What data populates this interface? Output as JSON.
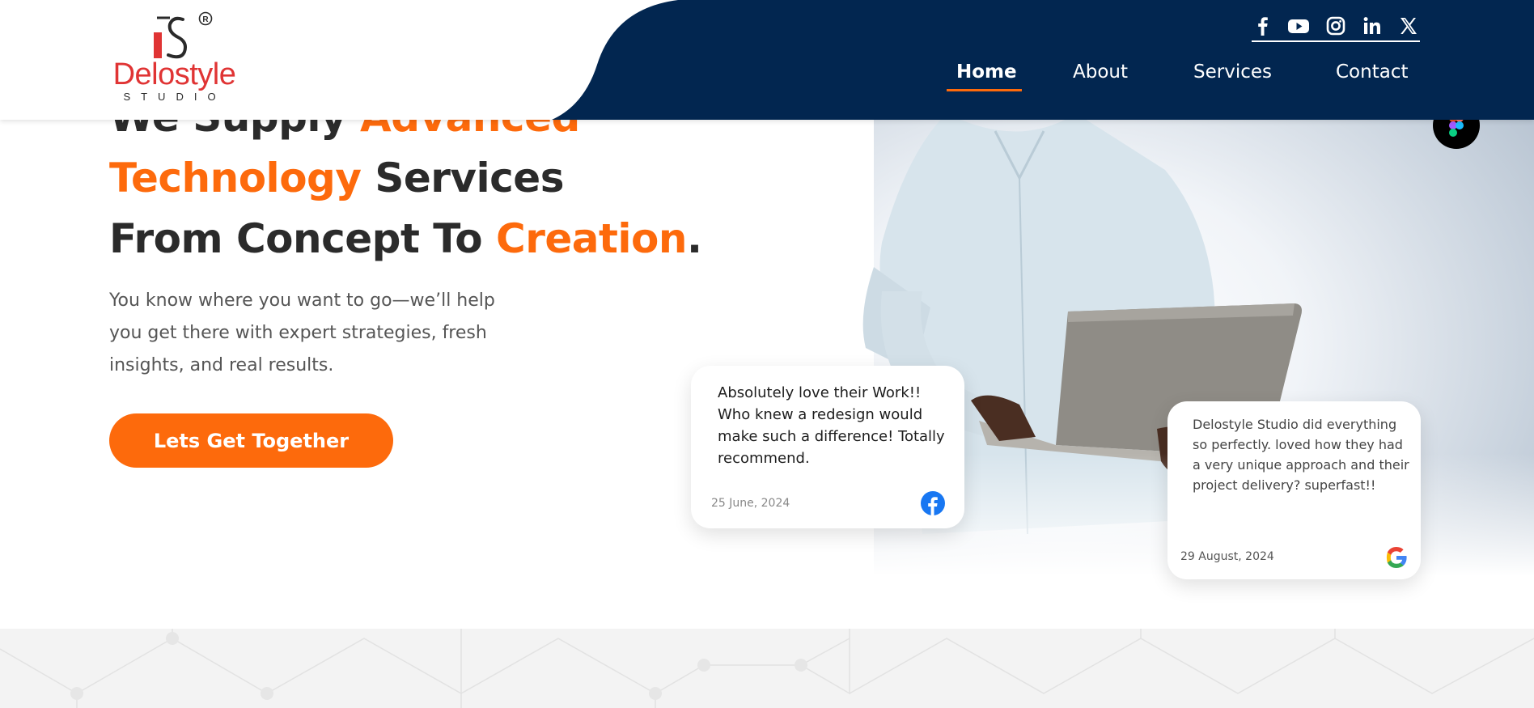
{
  "brand": {
    "name": "Delostyle",
    "subtitle": "STUDIO",
    "mark": "DS",
    "registered": "®",
    "primary_color": "#fd6a0c",
    "navy_color": "#022650",
    "logo_red": "#e03434"
  },
  "social": {
    "icons": [
      "facebook-icon",
      "youtube-icon",
      "instagram-icon",
      "linkedin-icon",
      "x-icon"
    ]
  },
  "nav": {
    "items": [
      {
        "label": "Home",
        "active": true
      },
      {
        "label": "About",
        "active": false
      },
      {
        "label": "Services",
        "active": false
      },
      {
        "label": "Contact",
        "active": false
      }
    ]
  },
  "hero": {
    "headline": {
      "line1_a": "We Supply ",
      "line1_b": "Advanced",
      "line2_a": "Technology",
      "line2_b": " Services",
      "line3_a": "From Concept To ",
      "line3_b": "Creation",
      "line3_c": "."
    },
    "subtext": "You know where you want to go—we’ll help you get there with expert strategies, fresh insights, and real results.",
    "cta_label": "Lets Get Together"
  },
  "reviews": [
    {
      "text": "Absolutely love their Work!! Who knew a redesign would make such a difference! Totally recommend.",
      "date": "25 June, 2024",
      "source_icon": "facebook-icon"
    },
    {
      "text": "Delostyle Studio did everything so perfectly. loved how they had a very unique approach and their project delivery? superfast!!",
      "date": "29 August, 2024",
      "source_icon": "google-icon"
    }
  ],
  "floating": {
    "icon": "figma-icon"
  }
}
